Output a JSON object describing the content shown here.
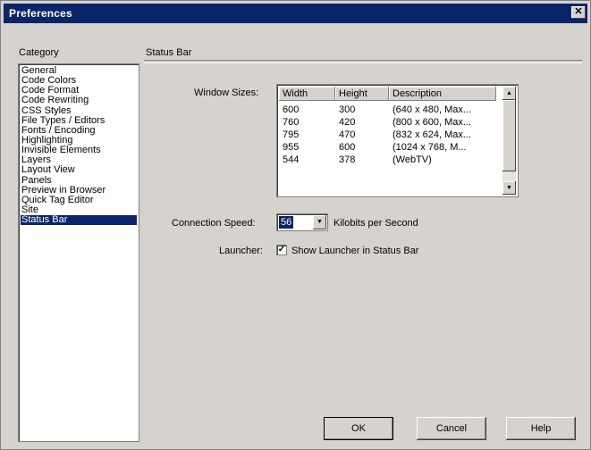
{
  "window": {
    "title": "Preferences",
    "close_glyph": "✕"
  },
  "category": {
    "label": "Category",
    "items": [
      "General",
      "Code Colors",
      "Code Format",
      "Code Rewriting",
      "CSS Styles",
      "File Types / Editors",
      "Fonts / Encoding",
      "Highlighting",
      "Invisible Elements",
      "Layers",
      "Layout View",
      "Panels",
      "Preview in Browser",
      "Quick Tag Editor",
      "Site",
      "Status Bar"
    ],
    "selected": "Status Bar"
  },
  "panel": {
    "title": "Status Bar"
  },
  "window_sizes": {
    "label": "Window Sizes:",
    "columns": [
      "Width",
      "Height",
      "Description"
    ],
    "rows": [
      {
        "width": "600",
        "height": "300",
        "description": "(640 x 480, Max..."
      },
      {
        "width": "760",
        "height": "420",
        "description": "(800 x 600, Max..."
      },
      {
        "width": "795",
        "height": "470",
        "description": "(832 x 624, Max..."
      },
      {
        "width": "955",
        "height": "600",
        "description": "(1024 x 768, M..."
      },
      {
        "width": "544",
        "height": "378",
        "description": "(WebTV)"
      }
    ],
    "scroll_up_glyph": "▲",
    "scroll_down_glyph": "▼"
  },
  "connection": {
    "label": "Connection Speed:",
    "value": "56",
    "units": "Kilobits per Second",
    "arrow_glyph": "▼"
  },
  "launcher": {
    "label": "Launcher:",
    "checkbox_label": "Show Launcher in Status Bar",
    "checked": true,
    "check_glyph": "✓"
  },
  "buttons": {
    "ok": "OK",
    "cancel": "Cancel",
    "help": "Help"
  },
  "colors": {
    "face": "#d6d3ce",
    "title_bar": "#0a246a",
    "selection": "#0a246a"
  }
}
